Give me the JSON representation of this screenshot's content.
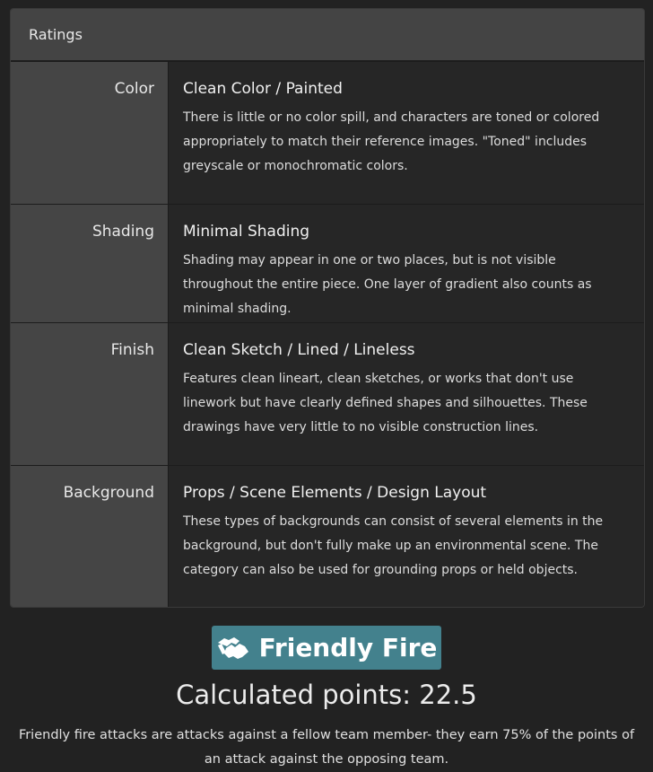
{
  "card": {
    "header": "Ratings",
    "ratings": [
      {
        "label": "Color",
        "title": "Clean Color / Painted",
        "description": "There is little or no color spill, and characters are toned or colored appropriately to match their reference images. \"Toned\" includes greyscale or monochromatic colors."
      },
      {
        "label": "Shading",
        "title": "Minimal Shading",
        "description": "Shading may appear in one or two places, but is not visible throughout the entire piece. One layer of gradient also counts as minimal shading."
      },
      {
        "label": "Finish",
        "title": "Clean Sketch / Lined / Lineless",
        "description": "Features clean lineart, clean sketches, or works that don't use linework but have clearly defined shapes and silhouettes. These drawings have very little to no visible construction lines."
      },
      {
        "label": "Background",
        "title": "Props / Scene Elements / Design Layout",
        "description": "These types of backgrounds can consist of several elements in the background, but don't fully make up an environmental scene. The category can also be used for grounding props or held objects."
      }
    ]
  },
  "attack": {
    "badge_label": "Friendly Fire",
    "badge_icon": "handshake-icon",
    "badge_color": "#43818d",
    "points_text": "Calculated points: 22.5",
    "note": "Friendly fire attacks are attacks against a fellow team member- they earn 75% of the points of an attack against the opposing team."
  }
}
